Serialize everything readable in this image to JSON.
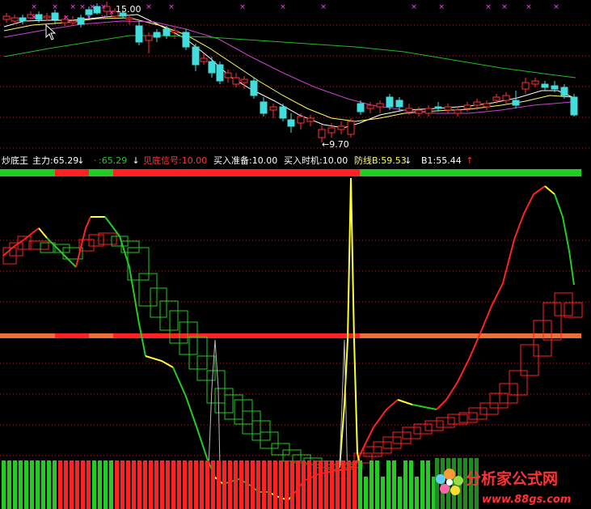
{
  "chart_data": [
    {
      "type": "candlestick",
      "title": "",
      "annotations": {
        "high_label": "15.00",
        "low_label": "←9.70",
        "marker_glyph": "×"
      },
      "moving_averages": [
        {
          "color": "#ffffff"
        },
        {
          "color": "#ffff66"
        },
        {
          "color": "#cc44cc"
        },
        {
          "color": "#22bb22"
        }
      ]
    },
    {
      "type": "line",
      "indicator_name": "炒底王",
      "legend": [
        {
          "label": "主力:65.29",
          "arrow": "↓",
          "color": "#ffffff",
          "arrow_color": "#ffffff"
        },
        {
          "label": ":65.29",
          "prefix": "·",
          "arrow": "↓",
          "color": "#22cc22",
          "arrow_color": "#ffffff"
        },
        {
          "label": "见底信号:10.00",
          "arrow": "",
          "color": "#ff3333",
          "arrow_color": ""
        },
        {
          "label": "买入准备:10.00",
          "arrow": "",
          "color": "#ffffff",
          "arrow_color": ""
        },
        {
          "label": "买入时机:10.00",
          "arrow": "",
          "color": "#ffffff",
          "arrow_color": ""
        },
        {
          "label": "防线B:59.53",
          "arrow": "↓",
          "color": "#ffff44",
          "arrow_color": "#ffffff"
        },
        {
          "label": "B1:55.44",
          "arrow": "↑",
          "color": "#ffffff",
          "arrow_color": "#ff3333"
        }
      ],
      "colors": {
        "rise": "#ff2222",
        "fall": "#22cc22",
        "mid": "#ffff33",
        "level": "#e8703a",
        "grid": "#aa2222",
        "spike": "#ffff33",
        "spike_inner": "#bbbbbb"
      }
    }
  ],
  "watermark": {
    "name": "分析家公式网",
    "url": "www.88gs.com"
  }
}
